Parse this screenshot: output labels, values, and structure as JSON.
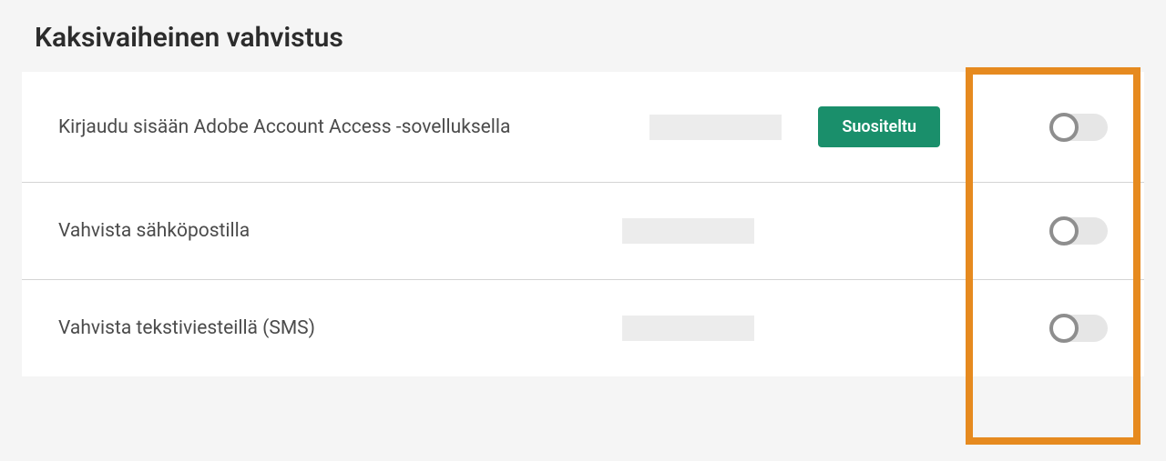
{
  "section": {
    "title": "Kaksivaiheinen vahvistus"
  },
  "rows": [
    {
      "label": "Kirjaudu sisään Adobe Account Access -sovelluksella",
      "badge": "Suositeltu"
    },
    {
      "label": "Vahvista sähköpostilla"
    },
    {
      "label": "Vahvista tekstiviesteillä (SMS)"
    }
  ]
}
